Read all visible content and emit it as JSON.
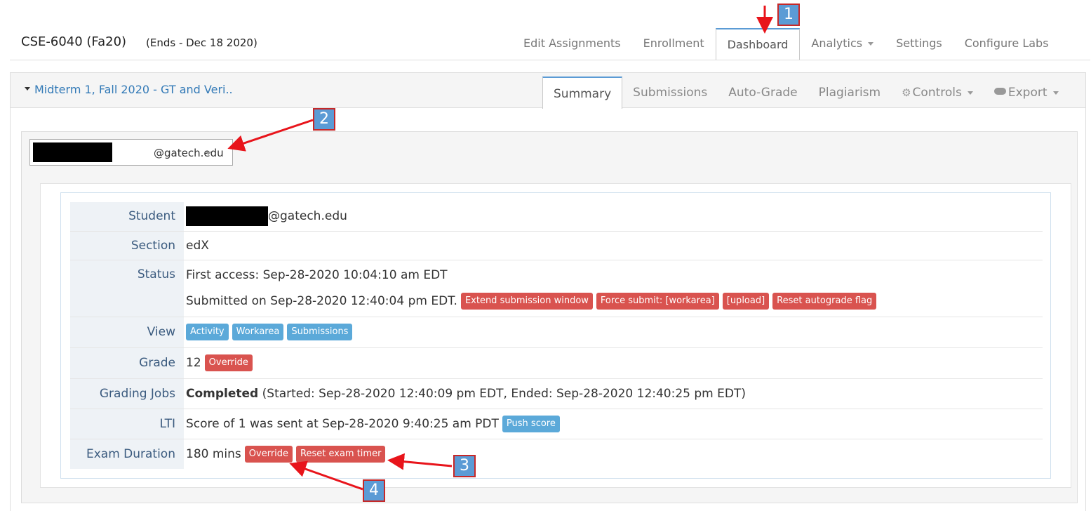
{
  "course": {
    "title": "CSE-6040 (Fa20)",
    "ends": "(Ends - Dec 18 2020)"
  },
  "top_nav": [
    "Edit Assignments",
    "Enrollment",
    "Dashboard",
    "Analytics",
    "Settings",
    "Configure Labs"
  ],
  "assignment": {
    "title": "Midterm 1, Fall 2020 - GT and Veri..",
    "tabs": [
      "Summary",
      "Submissions",
      "Auto-Grade",
      "Plagiarism",
      "Controls",
      "Export"
    ]
  },
  "student_select": {
    "domain": "@gatech.edu"
  },
  "details": {
    "student": {
      "label": "Student",
      "value": "@gatech.edu"
    },
    "section": {
      "label": "Section",
      "value": "edX"
    },
    "status": {
      "label": "Status",
      "first_access": "First access: Sep-28-2020 10:04:10 am EDT",
      "submitted": "Submitted on Sep-28-2020 12:40:04 pm EDT.",
      "buttons": [
        "Extend submission window",
        "Force submit: [workarea]",
        "[upload]",
        "Reset autograde flag"
      ]
    },
    "view": {
      "label": "View",
      "buttons": [
        "Activity",
        "Workarea",
        "Submissions"
      ]
    },
    "grade": {
      "label": "Grade",
      "value": "12",
      "button": "Override"
    },
    "grading_jobs": {
      "label": "Grading Jobs",
      "status": "Completed",
      "detail": "(Started: Sep-28-2020 12:40:09 pm EDT, Ended: Sep-28-2020 12:40:25 pm EDT)"
    },
    "lti": {
      "label": "LTI",
      "value": "Score of 1 was sent at Sep-28-2020 9:40:25 am PDT",
      "button": "Push score"
    },
    "exam_duration": {
      "label": "Exam Duration",
      "value": "180 mins",
      "buttons": [
        "Override",
        "Reset exam timer"
      ]
    }
  },
  "annotations": [
    "1",
    "2",
    "3",
    "4"
  ],
  "colors": {
    "accent": "#337ab7",
    "danger": "#d9534f",
    "info": "#5ba9d9",
    "annotation_box": "#5b9bd5",
    "arrow": "#e8141b"
  }
}
